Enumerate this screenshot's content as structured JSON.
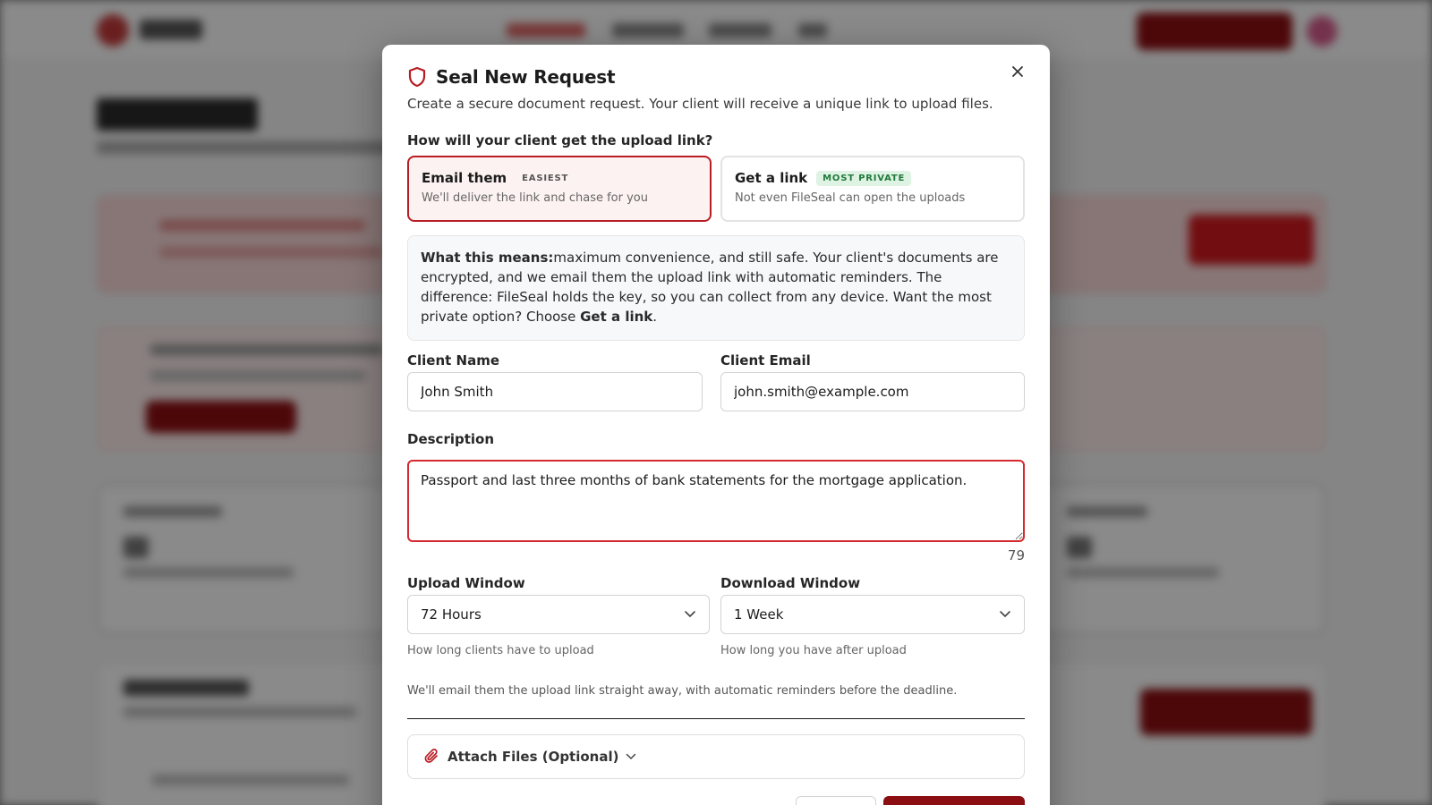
{
  "modal": {
    "title": "Seal New Request",
    "description": "Create a secure document request. Your client will receive a unique link to upload files.",
    "delivery_question": "How will your client get the upload link?",
    "options": [
      {
        "title": "Email them",
        "badge": "EASIEST",
        "subtitle": "We'll deliver the link and chase for you",
        "selected": true
      },
      {
        "title": "Get a link",
        "badge": "MOST PRIVATE",
        "subtitle": "Not even FileSeal can open the uploads",
        "selected": false
      }
    ],
    "info": {
      "lead": "What this means:",
      "body": "maximum convenience, and still safe. Your client's documents are encrypted, and we email them the upload link with automatic reminders. The difference: FileSeal holds the key, so you can collect from any device. Want the most private option? Choose ",
      "emphasis": "Get a link",
      "tail": "."
    },
    "client_name": {
      "label": "Client Name",
      "value": "John Smith"
    },
    "client_email": {
      "label": "Client Email",
      "value": "john.smith@example.com"
    },
    "description_field": {
      "label": "Description",
      "value": "Passport and last three months of bank statements for the mortgage application.",
      "char_count": "79"
    },
    "upload_window": {
      "label": "Upload Window",
      "value": "72 Hours",
      "hint": "How long clients have to upload"
    },
    "download_window": {
      "label": "Download Window",
      "value": "1 Week",
      "hint": "How long you have after upload"
    },
    "notice": "We'll email them the upload link straight away, with automatic reminders before the deadline.",
    "attach_label": "Attach Files (Optional)"
  },
  "colors": {
    "accent": "#b81d24",
    "primary_button": "#8b0e12",
    "private_badge_bg": "#dff3e4",
    "private_badge_text": "#1f7a3b"
  },
  "icons": {
    "title": "shield-icon",
    "close": "close-icon",
    "attach": "paperclip-icon",
    "select": "chevron-down-icon"
  }
}
